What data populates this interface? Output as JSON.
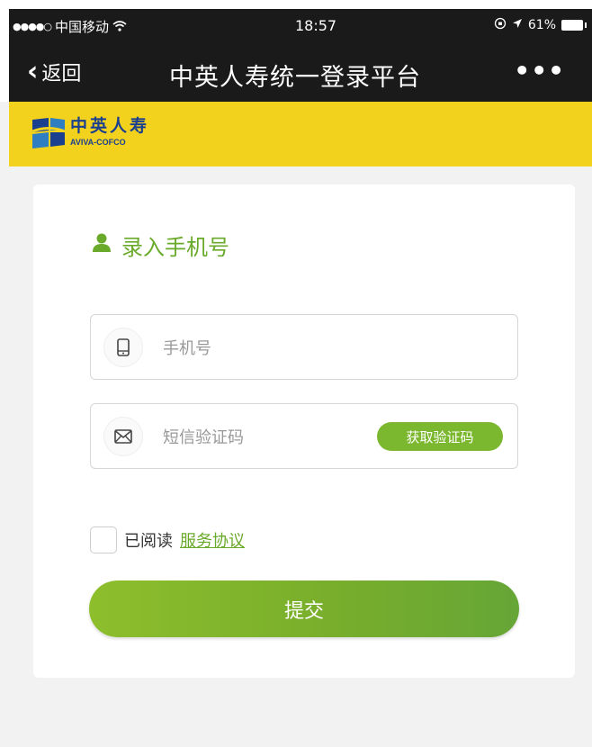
{
  "status_bar": {
    "signal": "●●●●○",
    "carrier": "中国移动",
    "wifi_icon": "wifi-icon",
    "time": "18:57",
    "battery_percent": "61%",
    "battery_level": 0.61
  },
  "nav": {
    "back_label": "返回",
    "title": "中英人寿统一登录平台",
    "more_label": "•••"
  },
  "brand": {
    "name_cn": "中英人寿",
    "name_en": "AVIVA-COFCO",
    "bar_color": "#f3d21e",
    "logo_blue": "#1b3f8f"
  },
  "form": {
    "section_title": "录入手机号",
    "phone_placeholder": "手机号",
    "phone_value": "",
    "code_placeholder": "短信验证码",
    "code_value": "",
    "get_code_label": "获取验证码",
    "agree_prefix": "已阅读",
    "agree_link": "服务协议",
    "agree_checked": false,
    "submit_label": "提交"
  },
  "colors": {
    "accent": "#7cb82f",
    "nav_bg": "#1a1a1a",
    "page_bg": "#f2f2f2"
  }
}
